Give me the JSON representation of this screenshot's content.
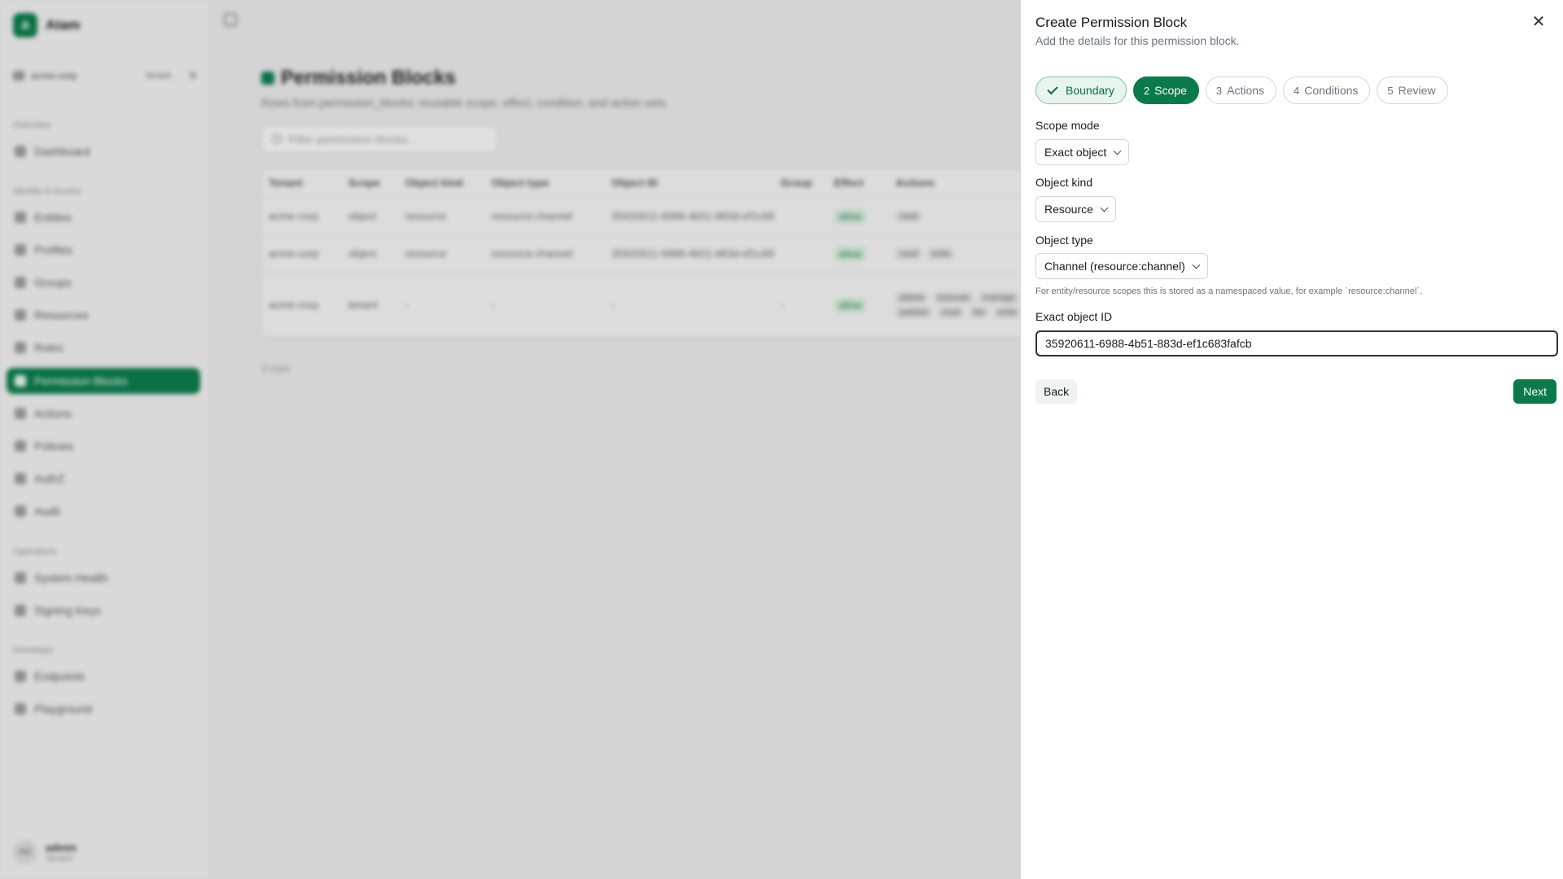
{
  "app": {
    "name": "Atam",
    "logo_letter": "A"
  },
  "sidebar": {
    "tenant_name": "acme-corp",
    "tenant_badge": "tenant",
    "switch_icon": "swap-icon",
    "sections": [
      {
        "label": "Overview"
      },
      {
        "label": "Identity & Access"
      },
      {
        "label": "Operations"
      },
      {
        "label": "Developer"
      }
    ],
    "items": [
      {
        "label": "Dashboard",
        "icon": "home-icon"
      },
      {
        "label": "Entities",
        "icon": "entities-icon"
      },
      {
        "label": "Profiles",
        "icon": "profiles-icon"
      },
      {
        "label": "Groups",
        "icon": "groups-icon"
      },
      {
        "label": "Resources",
        "icon": "resources-icon"
      },
      {
        "label": "Roles",
        "icon": "roles-icon"
      },
      {
        "label": "Permission Blocks",
        "icon": "permission-blocks-icon",
        "active": true
      },
      {
        "label": "Actions",
        "icon": "actions-icon"
      },
      {
        "label": "Policies",
        "icon": "policies-icon"
      },
      {
        "label": "AuthZ",
        "icon": "authz-icon"
      },
      {
        "label": "Audit",
        "icon": "audit-icon"
      },
      {
        "label": "System Health",
        "icon": "health-icon"
      },
      {
        "label": "Signing Keys",
        "icon": "key-icon"
      },
      {
        "label": "Endpoints",
        "icon": "endpoints-icon"
      },
      {
        "label": "Playground",
        "icon": "playground-icon"
      }
    ],
    "user": {
      "initials": "AD",
      "name": "admin",
      "role": "Tenant"
    }
  },
  "main": {
    "title": "Permission Blocks",
    "subtitle": "Rows from permission_blocks: reusable scope, effect, condition, and action sets.",
    "filter_placeholder": "Filter permission blocks...",
    "table": {
      "columns": [
        "Tenant",
        "Scope",
        "Object kind",
        "Object type",
        "Object ID",
        "Group",
        "Effect",
        "Actions"
      ],
      "rows": [
        {
          "tenant": "acme-corp",
          "scope": "object",
          "kind": "resource",
          "type": "resource:channel",
          "id": "35920611-6988-4b51-883d-ef1c683fafcb",
          "group": "",
          "effect": "allow",
          "actions": [
            "read"
          ]
        },
        {
          "tenant": "acme-corp",
          "scope": "object",
          "kind": "resource",
          "type": "resource:channel",
          "id": "35920611-6988-4b51-883d-ef1c683fafcb",
          "group": "",
          "effect": "allow",
          "actions": [
            "read",
            "write"
          ]
        },
        {
          "tenant": "acme-corp",
          "scope": "tenant",
          "kind": "-",
          "type": "-",
          "id": "-",
          "group": "-",
          "effect": "allow",
          "actions": [
            "delete",
            "execute",
            "manage",
            "publish",
            "read",
            "list",
            "write"
          ]
        }
      ]
    },
    "row_count": "3 rows"
  },
  "drawer": {
    "title": "Create Permission Block",
    "subtitle": "Add the details for this permission block.",
    "steps": [
      {
        "num": "",
        "label": "Boundary",
        "state": "done"
      },
      {
        "num": "2",
        "label": "Scope",
        "state": "current"
      },
      {
        "num": "3",
        "label": "Actions",
        "state": "upcoming"
      },
      {
        "num": "4",
        "label": "Conditions",
        "state": "upcoming"
      },
      {
        "num": "5",
        "label": "Review",
        "state": "upcoming"
      }
    ],
    "scope_mode": {
      "label": "Scope mode",
      "value": "Exact object"
    },
    "object_kind": {
      "label": "Object kind",
      "value": "Resource"
    },
    "object_type": {
      "label": "Object type",
      "value": "Channel (resource:channel)"
    },
    "hint": "For entity/resource scopes this is stored as a namespaced value, for example `resource:channel`.",
    "object_id": {
      "label": "Exact object ID",
      "value": "35920611-6988-4b51-883d-ef1c683fafcb"
    },
    "back_label": "Back",
    "next_label": "Next",
    "close_icon": "close-icon"
  },
  "colors": {
    "accent": "#0b7a4b",
    "accent_light": "#e7f5ed"
  }
}
